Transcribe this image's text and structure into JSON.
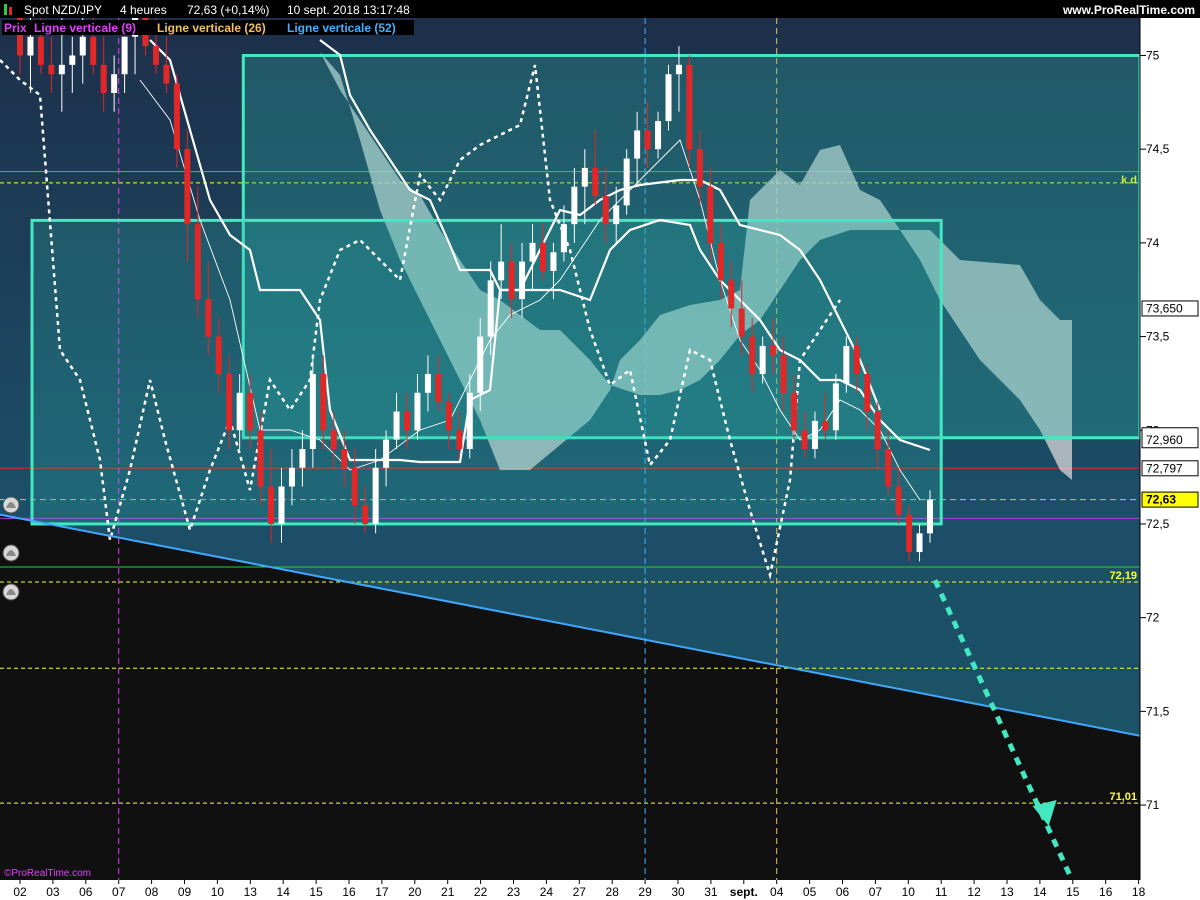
{
  "header": {
    "instrument": "Spot NZD/JPY",
    "timeframe": "4 heures",
    "quote": "72,63 (+0,14%)",
    "datetime": "10 sept. 2018 13:17:48",
    "site": "www.ProRealTime.com"
  },
  "legend": [
    {
      "label": "Prix",
      "color": "#e040fb"
    },
    {
      "label": "Ligne verticale (9)",
      "color": "#e040fb"
    },
    {
      "label": "Ligne verticale (26)",
      "color": "#f0c060"
    },
    {
      "label": "Ligne verticale (52)",
      "color": "#40b0ff"
    }
  ],
  "footer": {
    "copyright": "©ProRealTime.com"
  },
  "colors": {
    "up": "#ffffff",
    "down": "#e02828",
    "box": "#44e8c0",
    "trend": "#40a8ff",
    "cloud": "#d8d8d8",
    "teal": "#1e7f86"
  },
  "chart_data": {
    "type": "candlestick",
    "yaxis": {
      "min": 70.6,
      "max": 75.2,
      "ticks": [
        "75",
        "74,5",
        "74",
        "73,5",
        "73",
        "72,5",
        "72",
        "71,5",
        "71"
      ]
    },
    "xaxis": {
      "labels": [
        "02",
        "03",
        "06",
        "07",
        "08",
        "09",
        "10",
        "13",
        "14",
        "15",
        "16",
        "17",
        "20",
        "21",
        "22",
        "23",
        "24",
        "27",
        "28",
        "29",
        "30",
        "31",
        "sept.",
        "04",
        "05",
        "06",
        "07",
        "10",
        "11",
        "12",
        "13",
        "14",
        "15",
        "16",
        "18"
      ]
    },
    "price_labels": [
      {
        "text": "73,650",
        "value": 73.65,
        "style": "white"
      },
      {
        "text": "72,960",
        "value": 72.96,
        "style": "white-large"
      },
      {
        "text": "72,797",
        "value": 72.797,
        "style": "white"
      },
      {
        "text": "72,63",
        "value": 72.63,
        "style": "yellow"
      },
      {
        "text": "72,19",
        "value": 72.19,
        "style": "level"
      },
      {
        "text": "71,01",
        "value": 71.01,
        "style": "level"
      }
    ],
    "annotations": {
      "kd": "k d"
    },
    "levels": {
      "yellow_dashed": [
        74.32,
        72.19,
        71.73,
        71.01
      ],
      "green_solid": [
        74.38,
        72.27
      ],
      "red_solid": 72.797,
      "pink_dashed": 72.63,
      "purple_solid": 72.53
    },
    "vertical_lines": [
      {
        "x_label": "29",
        "color": "#40b0ff"
      },
      {
        "x_label": "04",
        "color": "#f0c060"
      },
      {
        "x_label": "07",
        "color": "#e040fb"
      }
    ],
    "boxes": [
      {
        "from": "13",
        "to": "fin",
        "top": 75.0,
        "bottom": 72.96
      },
      {
        "from": "02",
        "to": "11",
        "top": 74.12,
        "bottom": 72.5
      }
    ],
    "trendline": {
      "start": 72.55,
      "end": 71.37
    },
    "projection": {
      "start": 72.2,
      "end": 70.6
    },
    "candles": [
      [
        75.2,
        75.4,
        74.9,
        75.0
      ],
      [
        75.0,
        75.2,
        74.8,
        75.1
      ],
      [
        75.1,
        75.3,
        74.9,
        74.95
      ],
      [
        74.95,
        75.1,
        74.8,
        74.9
      ],
      [
        74.9,
        75.2,
        74.7,
        74.95
      ],
      [
        74.95,
        75.1,
        74.8,
        75.0
      ],
      [
        75.0,
        75.3,
        74.85,
        75.1
      ],
      [
        75.1,
        75.2,
        74.9,
        74.95
      ],
      [
        74.95,
        75.1,
        74.7,
        74.8
      ],
      [
        74.8,
        75.0,
        74.7,
        74.9
      ],
      [
        74.9,
        75.1,
        74.8,
        75.1
      ],
      [
        75.1,
        75.3,
        74.9,
        75.2
      ],
      [
        75.2,
        75.3,
        75.0,
        75.05
      ],
      [
        75.05,
        75.2,
        74.9,
        74.95
      ],
      [
        74.95,
        75.1,
        74.8,
        74.85
      ],
      [
        74.85,
        74.9,
        74.4,
        74.5
      ],
      [
        74.5,
        74.6,
        73.9,
        74.1
      ],
      [
        74.1,
        74.3,
        73.6,
        73.7
      ],
      [
        73.7,
        73.9,
        73.4,
        73.5
      ],
      [
        73.5,
        73.6,
        73.2,
        73.3
      ],
      [
        73.3,
        73.4,
        72.9,
        73.0
      ],
      [
        73.0,
        73.3,
        72.9,
        73.2
      ],
      [
        73.2,
        73.3,
        72.9,
        73.0
      ],
      [
        73.0,
        73.1,
        72.6,
        72.7
      ],
      [
        72.7,
        72.9,
        72.4,
        72.5
      ],
      [
        72.5,
        72.8,
        72.4,
        72.7
      ],
      [
        72.7,
        72.9,
        72.6,
        72.8
      ],
      [
        72.8,
        73.0,
        72.7,
        72.9
      ],
      [
        72.9,
        73.4,
        72.8,
        73.3
      ],
      [
        73.3,
        73.4,
        72.9,
        73.0
      ],
      [
        73.0,
        73.1,
        72.8,
        72.9
      ],
      [
        72.9,
        73.0,
        72.7,
        72.8
      ],
      [
        72.8,
        72.9,
        72.5,
        72.6
      ],
      [
        72.6,
        72.7,
        72.45,
        72.5
      ],
      [
        72.5,
        72.9,
        72.45,
        72.8
      ],
      [
        72.8,
        73.0,
        72.7,
        72.95
      ],
      [
        72.95,
        73.2,
        72.9,
        73.1
      ],
      [
        73.1,
        73.2,
        72.9,
        73.0
      ],
      [
        73.0,
        73.3,
        72.95,
        73.2
      ],
      [
        73.2,
        73.4,
        73.1,
        73.3
      ],
      [
        73.3,
        73.4,
        73.1,
        73.15
      ],
      [
        73.15,
        73.2,
        72.9,
        73.0
      ],
      [
        73.0,
        73.1,
        72.85,
        72.9
      ],
      [
        72.9,
        73.3,
        72.85,
        73.2
      ],
      [
        73.2,
        73.6,
        73.1,
        73.5
      ],
      [
        73.5,
        73.9,
        73.4,
        73.8
      ],
      [
        73.8,
        74.1,
        73.7,
        73.9
      ],
      [
        73.9,
        74.0,
        73.6,
        73.7
      ],
      [
        73.7,
        74.0,
        73.6,
        73.9
      ],
      [
        73.9,
        74.1,
        73.75,
        74.0
      ],
      [
        74.0,
        74.1,
        73.8,
        73.85
      ],
      [
        73.85,
        74.0,
        73.7,
        73.95
      ],
      [
        73.95,
        74.2,
        73.9,
        74.1
      ],
      [
        74.1,
        74.4,
        74.0,
        74.3
      ],
      [
        74.3,
        74.5,
        74.1,
        74.4
      ],
      [
        74.4,
        74.6,
        74.2,
        74.25
      ],
      [
        74.25,
        74.4,
        74.0,
        74.1
      ],
      [
        74.1,
        74.3,
        74.0,
        74.2
      ],
      [
        74.2,
        74.5,
        74.15,
        74.45
      ],
      [
        74.45,
        74.7,
        74.3,
        74.6
      ],
      [
        74.6,
        74.75,
        74.4,
        74.5
      ],
      [
        74.5,
        74.7,
        74.45,
        74.65
      ],
      [
        74.65,
        74.95,
        74.6,
        74.9
      ],
      [
        74.9,
        75.05,
        74.7,
        74.95
      ],
      [
        74.95,
        75.0,
        74.4,
        74.5
      ],
      [
        74.5,
        74.6,
        74.2,
        74.3
      ],
      [
        74.3,
        74.4,
        73.9,
        74.0
      ],
      [
        74.0,
        74.1,
        73.7,
        73.8
      ],
      [
        73.8,
        73.9,
        73.55,
        73.65
      ],
      [
        73.65,
        73.8,
        73.4,
        73.5
      ],
      [
        73.5,
        73.6,
        73.2,
        73.3
      ],
      [
        73.3,
        73.5,
        73.25,
        73.45
      ],
      [
        73.45,
        73.6,
        73.3,
        73.4
      ],
      [
        73.4,
        73.5,
        73.1,
        73.2
      ],
      [
        73.2,
        73.3,
        72.95,
        73.0
      ],
      [
        73.0,
        73.1,
        72.85,
        72.9
      ],
      [
        72.9,
        73.1,
        72.85,
        73.05
      ],
      [
        73.05,
        73.2,
        72.95,
        73.0
      ],
      [
        73.0,
        73.3,
        72.95,
        73.25
      ],
      [
        73.25,
        73.5,
        73.2,
        73.45
      ],
      [
        73.45,
        73.5,
        73.2,
        73.3
      ],
      [
        73.3,
        73.35,
        73.0,
        73.1
      ],
      [
        73.1,
        73.15,
        72.8,
        72.9
      ],
      [
        72.9,
        73.0,
        72.65,
        72.7
      ],
      [
        72.7,
        72.8,
        72.5,
        72.55
      ],
      [
        72.55,
        72.6,
        72.3,
        72.35
      ],
      [
        72.35,
        72.5,
        72.3,
        72.45
      ],
      [
        72.45,
        72.68,
        72.4,
        72.63
      ]
    ]
  }
}
